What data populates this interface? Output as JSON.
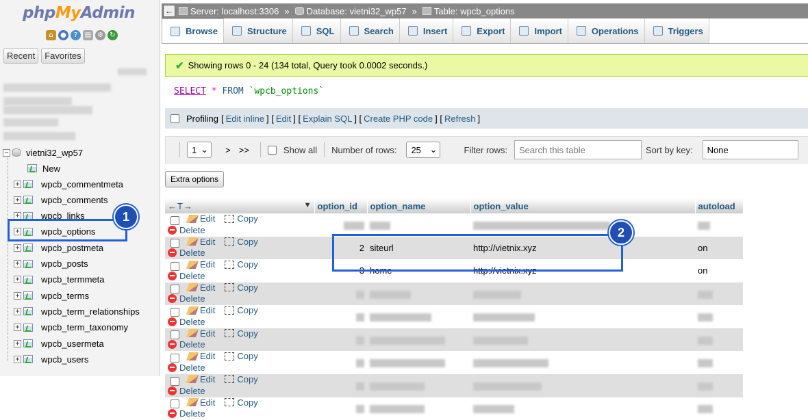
{
  "logo": {
    "php": "php",
    "my": "My",
    "admin": "Admin"
  },
  "nav": {
    "tabs": [
      "Recent",
      "Favorites"
    ],
    "database": "vietni32_wp57",
    "new_label": "New",
    "tables": [
      "wpcb_commentmeta",
      "wpcb_comments",
      "wpcb_links",
      "wpcb_options",
      "wpcb_postmeta",
      "wpcb_posts",
      "wpcb_termmeta",
      "wpcb_terms",
      "wpcb_term_relationships",
      "wpcb_term_taxonomy",
      "wpcb_usermeta",
      "wpcb_users"
    ]
  },
  "breadcrumb": {
    "server": "Server: localhost:3306",
    "database": "Database: vietni32_wp57",
    "table": "Table: wpcb_options",
    "sep": "»"
  },
  "tabs": [
    "Browse",
    "Structure",
    "SQL",
    "Search",
    "Insert",
    "Export",
    "Import",
    "Operations",
    "Triggers"
  ],
  "message": "Showing rows 0 - 24 (134 total, Query took 0.0002 seconds.)",
  "query": {
    "select": "SELECT",
    "star": "*",
    "from": "FROM",
    "table": "`wpcb_options`"
  },
  "profiling": {
    "label": "Profiling",
    "links": [
      "Edit inline",
      "Edit",
      "Explain SQL",
      "Create PHP code",
      "Refresh"
    ]
  },
  "navigation": {
    "page": "1",
    "next": ">",
    "last": ">>",
    "show_all": "Show all",
    "rows_label": "Number of rows:",
    "rows_value": "25",
    "filter_label": "Filter rows:",
    "filter_placeholder": "Search this table",
    "sort_label": "Sort by key:",
    "sort_value": "None"
  },
  "extra_options": "Extra options",
  "table": {
    "arrows": "←T→",
    "columns": [
      "option_id",
      "option_name",
      "option_value",
      "autoload"
    ],
    "actions": {
      "edit": "Edit",
      "copy": "Copy",
      "delete": "Delete"
    },
    "rows": [
      {
        "option_id": "",
        "option_name": "",
        "option_value": "",
        "autoload": "",
        "hidden": true
      },
      {
        "option_id": "2",
        "option_name": "siteurl",
        "option_value": "http://vietnix.xyz",
        "autoload": "on"
      },
      {
        "option_id": "3",
        "option_name": "home",
        "option_value": "http://vietnix.xyz",
        "autoload": "on"
      },
      {
        "option_id": "",
        "option_name": "",
        "option_value": "",
        "autoload": "",
        "hidden": true
      },
      {
        "option_id": "",
        "option_name": "",
        "option_value": "",
        "autoload": "",
        "hidden": true
      },
      {
        "option_id": "",
        "option_name": "",
        "option_value": "",
        "autoload": "",
        "hidden": true
      },
      {
        "option_id": "",
        "option_name": "",
        "option_value": "",
        "autoload": "",
        "hidden": true
      },
      {
        "option_id": "",
        "option_name": "",
        "option_value": "",
        "autoload": "",
        "hidden": true
      },
      {
        "option_id": "",
        "option_name": "",
        "option_value": "",
        "autoload": "",
        "hidden": true
      }
    ]
  },
  "annotations": {
    "badge1": "1",
    "badge2": "2",
    "color": "#2160d8"
  }
}
